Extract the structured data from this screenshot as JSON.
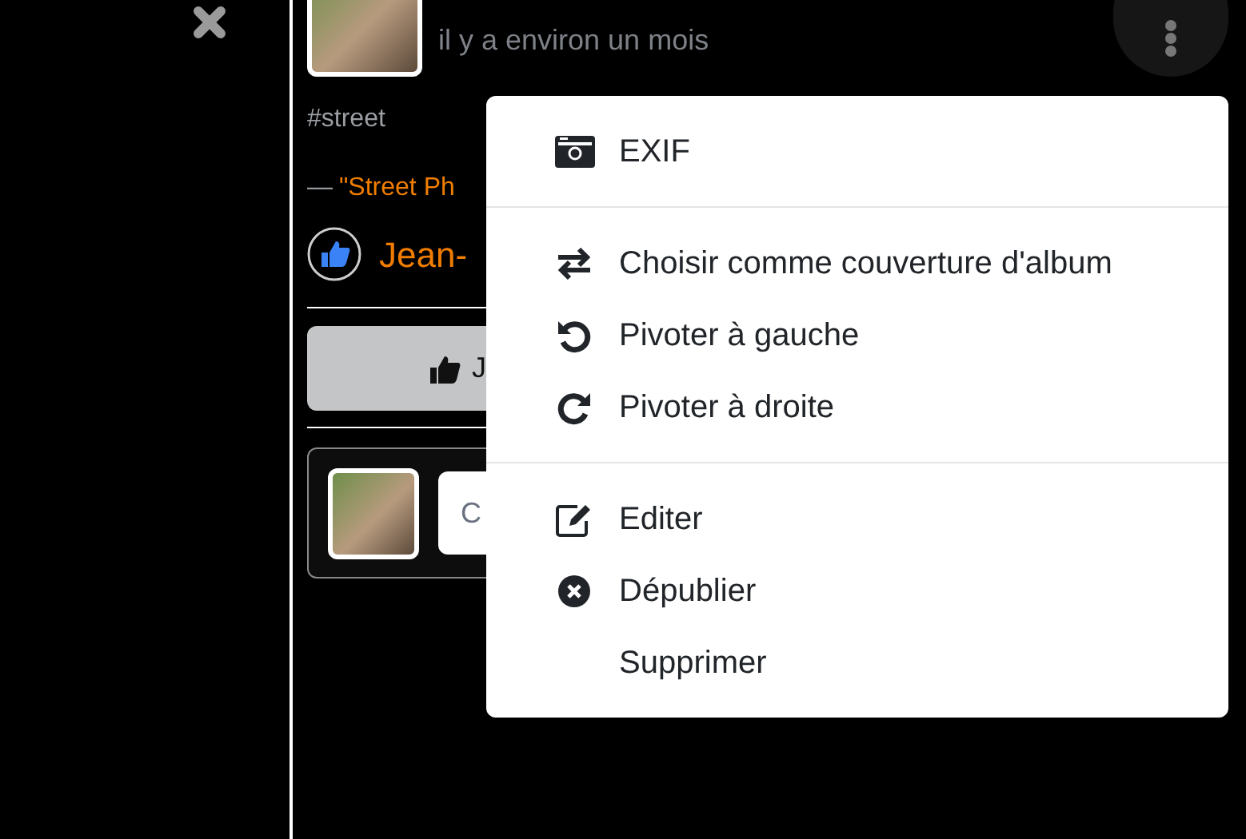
{
  "post": {
    "time": "il y a environ un mois",
    "tag": "#street",
    "album_prefix": "—",
    "album_link": "\"Street Ph",
    "liker": "Jean-",
    "like_button": "J",
    "comment_placeholder": "C"
  },
  "menu": {
    "sections": [
      [
        "EXIF"
      ],
      [
        "Choisir comme couverture d'album",
        "Pivoter à gauche",
        "Pivoter à droite"
      ],
      [
        "Editer",
        "Dépublier",
        "Supprimer"
      ]
    ]
  }
}
